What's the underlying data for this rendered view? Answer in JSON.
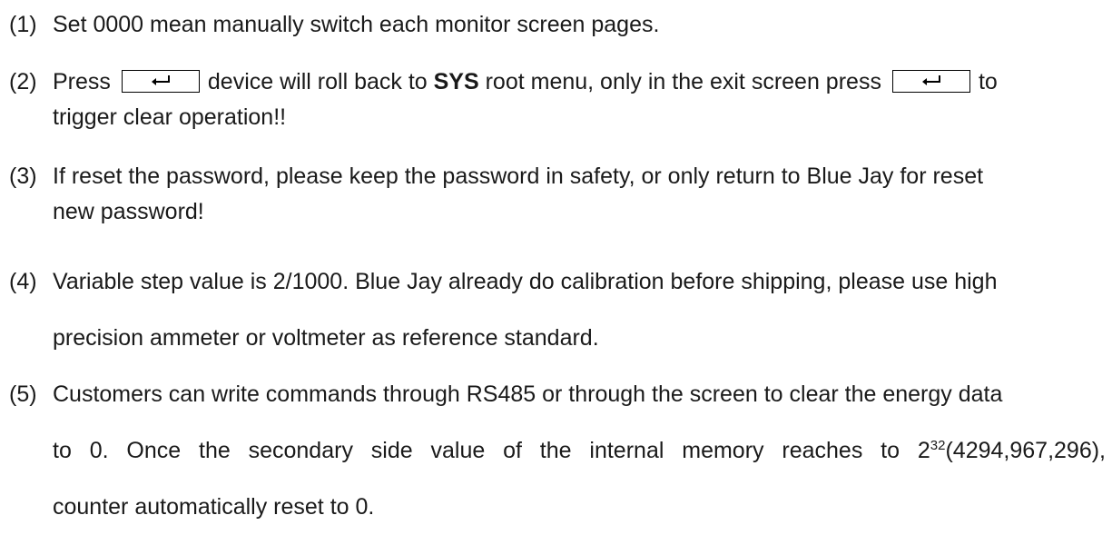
{
  "notes": [
    {
      "number": "(1)",
      "text": "Set 0000 mean manually switch each monitor screen pages."
    },
    {
      "number": "(2)",
      "part1": "Press",
      "part2": "device will roll back to",
      "bold": "SYS",
      "part3": "root menu, only in the exit screen press",
      "part4": "to",
      "line2": "trigger clear operation!!"
    },
    {
      "number": "(3)",
      "line1": "If reset the password, please keep the password in safety, or only return to Blue Jay for reset",
      "line2": "new password!"
    },
    {
      "number": "(4)",
      "line1": "Variable step value is 2/1000. Blue Jay already do calibration before shipping, please use high",
      "line2": "precision ammeter or voltmeter as reference standard."
    },
    {
      "number": "(5)",
      "line1": "Customers can write commands through RS485 or through the screen to clear the energy data",
      "line2a": "to 0. Once the secondary side value of the internal memory reaches to 2",
      "sup": "32",
      "line2b": "(4294,967,296),",
      "line3": "counter automatically reset to 0."
    }
  ],
  "icons": {
    "enter_key": "enter-key-icon"
  }
}
